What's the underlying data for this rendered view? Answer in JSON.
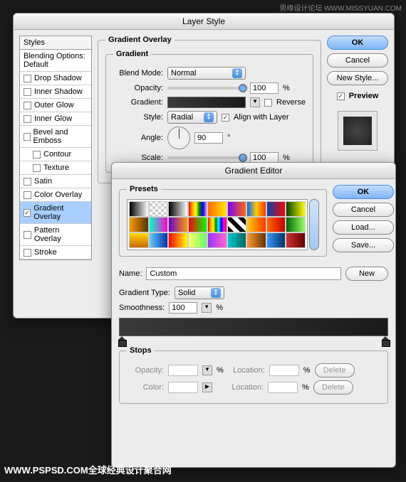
{
  "watermark_top": "思缘设计论坛 WWW.MISSYUAN.COM",
  "watermark_bottom": "WWW.PSPSD.COM全球经典设计聚合网",
  "layer_style": {
    "title": "Layer Style",
    "styles_header": "Styles",
    "items": [
      {
        "label": "Blending Options: Default",
        "checked": null
      },
      {
        "label": "Drop Shadow",
        "checked": false
      },
      {
        "label": "Inner Shadow",
        "checked": false
      },
      {
        "label": "Outer Glow",
        "checked": false
      },
      {
        "label": "Inner Glow",
        "checked": false
      },
      {
        "label": "Bevel and Emboss",
        "checked": false
      },
      {
        "label": "Contour",
        "checked": false,
        "indent": true
      },
      {
        "label": "Texture",
        "checked": false,
        "indent": true
      },
      {
        "label": "Satin",
        "checked": false
      },
      {
        "label": "Color Overlay",
        "checked": false
      },
      {
        "label": "Gradient Overlay",
        "checked": true,
        "selected": true
      },
      {
        "label": "Pattern Overlay",
        "checked": false
      },
      {
        "label": "Stroke",
        "checked": false
      }
    ],
    "section_title": "Gradient Overlay",
    "gradient_group": "Gradient",
    "blend_mode_label": "Blend Mode:",
    "blend_mode_value": "Normal",
    "opacity_label": "Opacity:",
    "opacity_value": "100",
    "gradient_label": "Gradient:",
    "reverse_label": "Reverse",
    "style_label": "Style:",
    "style_value": "Radial",
    "align_label": "Align with Layer",
    "angle_label": "Angle:",
    "angle_value": "90",
    "scale_label": "Scale:",
    "scale_value": "100",
    "ok": "OK",
    "cancel": "Cancel",
    "new_style": "New Style...",
    "preview": "Preview"
  },
  "gradient_editor": {
    "title": "Gradient Editor",
    "presets_label": "Presets",
    "ok": "OK",
    "cancel": "Cancel",
    "load": "Load...",
    "save": "Save...",
    "name_label": "Name:",
    "name_value": "Custom",
    "new_btn": "New",
    "type_label": "Gradient Type:",
    "type_value": "Solid",
    "smooth_label": "Smoothness:",
    "smooth_value": "100",
    "stops_label": "Stops",
    "opacity_label": "Opacity:",
    "location_label": "Location:",
    "color_label": "Color:",
    "delete": "Delete",
    "preset_gradients": [
      "linear-gradient(to right,#000,#fff)",
      "repeating-conic-gradient(#ccc 0 25%,#fff 0 50%) 0/8px 8px",
      "linear-gradient(to right,#000,#fff)",
      "linear-gradient(to right,red,orange,yellow,green,blue,violet)",
      "linear-gradient(to right,#ff6a00,#ffe600)",
      "linear-gradient(to right,#7a00ff,#ff6a00)",
      "linear-gradient(to right,#0066ff,#ffcc00,#ff3300)",
      "linear-gradient(to right,#0044aa,#ff0000)",
      "linear-gradient(to right,#004400,#ffff00)",
      "linear-gradient(to right,#ff9900,#553300)",
      "linear-gradient(to right,#00ffcc,#ff00cc)",
      "linear-gradient(to right,#6600cc,#ff9900)",
      "linear-gradient(to right,red,lime)",
      "linear-gradient(to right,red,orange,yellow,green,cyan,blue,magenta,red)",
      "repeating-linear-gradient(45deg,#000 0 6px,#fff 6px 12px)",
      "linear-gradient(to right,#ffcc00,#ff3300)",
      "linear-gradient(to right,#ff6600,#cc0000)",
      "linear-gradient(to right,#006600,#99ff66)",
      "linear-gradient(to bottom,#ffdd00,#cc6600)",
      "linear-gradient(to right,#66ccff,#0033aa)",
      "linear-gradient(to right,#ff0000,#ffff00)",
      "linear-gradient(to right,#ffff66,#66ff66)",
      "linear-gradient(to right,#9933ff,#ff66cc)",
      "linear-gradient(to right,#00cccc,#006666)",
      "linear-gradient(to right,#ff9933,#663300)",
      "linear-gradient(to right,#3399ff,#003366)",
      "linear-gradient(to right,#cc3333,#660000)"
    ]
  }
}
